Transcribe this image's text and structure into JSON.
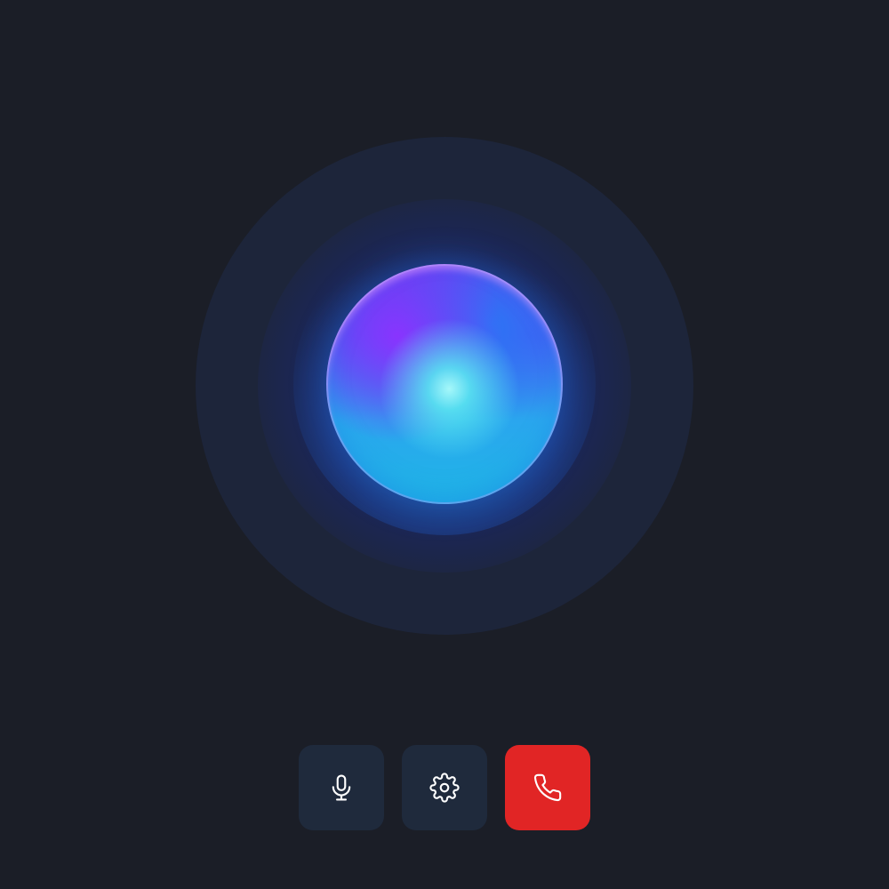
{
  "voice_orb": {
    "state": "listening",
    "colors": {
      "background": "#1b1e27",
      "halo": "#1d253a",
      "orb_top": "#6a3cf0",
      "orb_center": "#8ff5f5",
      "orb_bottom": "#1fb6e6"
    }
  },
  "controls": {
    "buttons": [
      {
        "id": "mute",
        "icon": "microphone-icon",
        "color": "#1f2a3c"
      },
      {
        "id": "settings",
        "icon": "gear-icon",
        "color": "#1f2a3c"
      },
      {
        "id": "end-call",
        "icon": "phone-icon",
        "color": "#e12525"
      }
    ]
  }
}
